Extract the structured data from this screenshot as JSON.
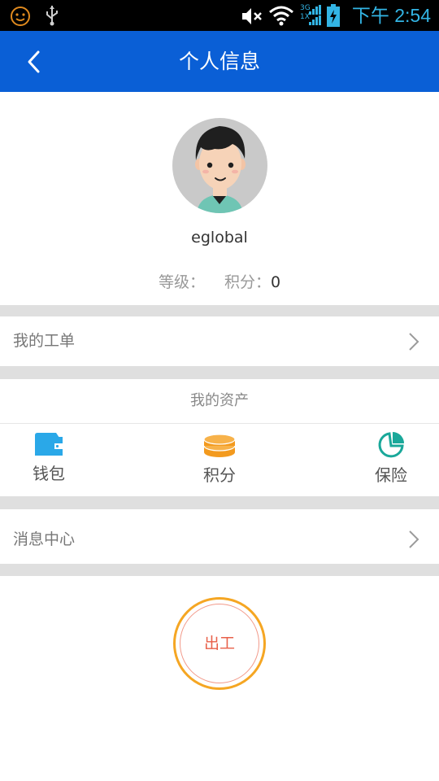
{
  "status_bar": {
    "time": "下午 2:54",
    "network_top": "3G",
    "network_bottom": "1X",
    "icons": [
      "emoji-icon",
      "usb-icon",
      "mute-icon",
      "wifi-icon",
      "signal-icon",
      "battery-charging-icon"
    ],
    "accent_color": "#33b5e5"
  },
  "header": {
    "title": "个人信息",
    "back_icon": "chevron-left-icon",
    "background_color": "#0a5fd6"
  },
  "profile": {
    "avatar_icon": "avatar-cartoon-boy",
    "username": "eglobal",
    "level_label": "等级：",
    "level_value": "",
    "points_label": "积分：",
    "points_value": "0"
  },
  "menu": {
    "work_orders_label": "我的工单",
    "messages_label": "消息中心",
    "chevron_icon": "chevron-right-icon"
  },
  "assets": {
    "title": "我的资产",
    "items": [
      {
        "label": "钱包",
        "icon": "wallet-icon",
        "color": "#2aa8e8"
      },
      {
        "label": "积分",
        "icon": "coins-icon",
        "color": "#f39a1e"
      },
      {
        "label": "保险",
        "icon": "pie-chart-icon",
        "color": "#1aa89a"
      }
    ]
  },
  "punch_button": {
    "label": "出工",
    "ring_color": "#f5a623",
    "text_color": "#e8604a"
  }
}
